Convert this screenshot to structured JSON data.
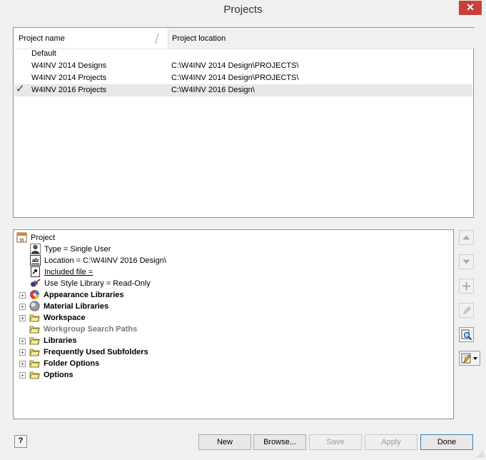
{
  "window": {
    "title": "Projects",
    "close_glyph": "✕"
  },
  "projects": {
    "headers": {
      "name": "Project name",
      "location": "Project location"
    },
    "rows": [
      {
        "name": "Default",
        "location": "",
        "active": false
      },
      {
        "name": "W4INV 2014 Designs",
        "location": "C:\\W4INV 2014 Design\\PROJECTS\\",
        "active": false
      },
      {
        "name": "W4INV 2014 Projects",
        "location": "C:\\W4INV 2014 Design\\PROJECTS\\",
        "active": false
      },
      {
        "name": "W4INV 2016 Projects",
        "location": "C:\\W4INV 2016 Design\\",
        "active": true
      }
    ],
    "active_check": "✓"
  },
  "tree": {
    "root": "Project",
    "type": "Type = Single User",
    "location": "Location = C:\\W4INV 2016 Design\\",
    "included_file": "Included file =",
    "style_library": "Use Style Library = Read-Only",
    "appearance_libraries": "Appearance Libraries",
    "material_libraries": "Material Libraries",
    "workspace": "Workspace",
    "workgroup_search_paths": "Workgroup Search Paths",
    "libraries": "Libraries",
    "frequently_used_subfolders": "Frequently Used Subfolders",
    "folder_options": "Folder Options",
    "options": "Options",
    "expander_glyph": "+"
  },
  "side_buttons": {
    "move_up": "▲",
    "move_down": "▼",
    "add": "+",
    "edit": "✎"
  },
  "buttons": {
    "help": "?",
    "new": "New",
    "browse": "Browse...",
    "save": "Save",
    "apply": "Apply",
    "done": "Done"
  }
}
